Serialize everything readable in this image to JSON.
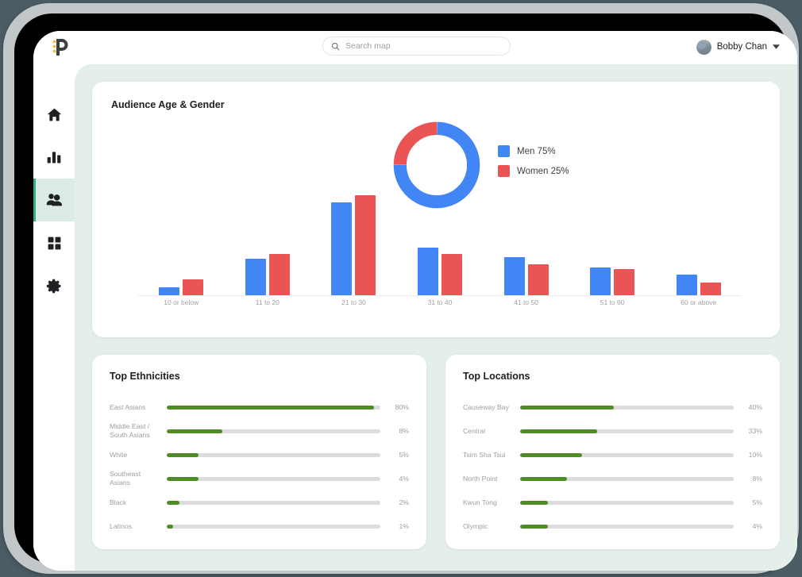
{
  "app": {
    "brand_logo": "p-logo-icon"
  },
  "topbar": {
    "search": {
      "placeholder": "Search map",
      "value": "",
      "icon": "search-icon"
    },
    "user": {
      "name": "Bobby Chan",
      "avatar": "user-avatar",
      "chevron": "chevron-down-icon"
    }
  },
  "sidebar": {
    "items": [
      {
        "name": "home",
        "icon": "home-icon",
        "active": false
      },
      {
        "name": "analytics",
        "icon": "bar-chart-icon",
        "active": false
      },
      {
        "name": "audience",
        "icon": "people-icon",
        "active": true
      },
      {
        "name": "apps",
        "icon": "grid-icon",
        "active": false
      },
      {
        "name": "settings",
        "icon": "gear-icon",
        "active": false
      }
    ],
    "active_accent": "#3aab86",
    "active_background": "#dcebe3"
  },
  "audience_card": {
    "title": "Audience Age & Gender"
  },
  "ethnicities_card": {
    "title": "Top Ethnicities"
  },
  "locations_card": {
    "title": "Top Locations"
  },
  "colors": {
    "men": "#4285f4",
    "women": "#ea5455",
    "bar_fill": "#4e8c26",
    "bar_track": "#dcdcdc",
    "page_background": "#e4efe9",
    "card_background": "#ffffff"
  },
  "chart_data": [
    {
      "type": "pie",
      "title": "Audience Gender",
      "donut": true,
      "labels": [
        "Men",
        "Women"
      ],
      "values": [
        75,
        25
      ],
      "legend": [
        "Men 75%",
        "Women 25%"
      ],
      "colors": [
        "#4285f4",
        "#ea5455"
      ],
      "legend_position": "right",
      "unit": "%"
    },
    {
      "type": "bar",
      "title": "Audience Age & Gender",
      "categories": [
        "10 or below",
        "11 to 20",
        "21 to 30",
        "31 to 40",
        "41 to 50",
        "51 to 60",
        "60 or above"
      ],
      "series": [
        {
          "name": "Men",
          "color": "#4285f4",
          "values": [
            8,
            35,
            90,
            46,
            37,
            27,
            20
          ]
        },
        {
          "name": "Women",
          "color": "#ea5455",
          "values": [
            15,
            40,
            97,
            40,
            30,
            25,
            12
          ]
        }
      ],
      "xlabel": "",
      "ylabel": "",
      "ylim": [
        0,
        100
      ],
      "grid": false,
      "legend_position": "top-right"
    },
    {
      "type": "bar",
      "orientation": "horizontal",
      "title": "Top Ethnicities",
      "categories": [
        "East Asians",
        "Middle East / South Asians",
        "White",
        "Southeast Asians",
        "Black",
        "Latinos"
      ],
      "values": [
        80,
        8,
        5,
        4,
        2,
        1
      ],
      "value_labels": [
        "80%",
        "8%",
        "5%",
        "4%",
        "2%",
        "1%"
      ],
      "bar_widths_pct": [
        97,
        26,
        15,
        15,
        6,
        3
      ],
      "unit": "%",
      "color": "#4e8c26"
    },
    {
      "type": "bar",
      "orientation": "horizontal",
      "title": "Top Locations",
      "categories": [
        "Causeway Bay",
        "Central",
        "Tsim Sha Tsui",
        "North Point",
        "Kwun Tong",
        "Olympic"
      ],
      "values": [
        40,
        33,
        10,
        8,
        5,
        4
      ],
      "value_labels": [
        "40%",
        "33%",
        "10%",
        "8%",
        "5%",
        "4%"
      ],
      "bar_widths_pct": [
        44,
        36,
        29,
        22,
        13,
        13
      ],
      "unit": "%",
      "color": "#4e8c26"
    }
  ]
}
